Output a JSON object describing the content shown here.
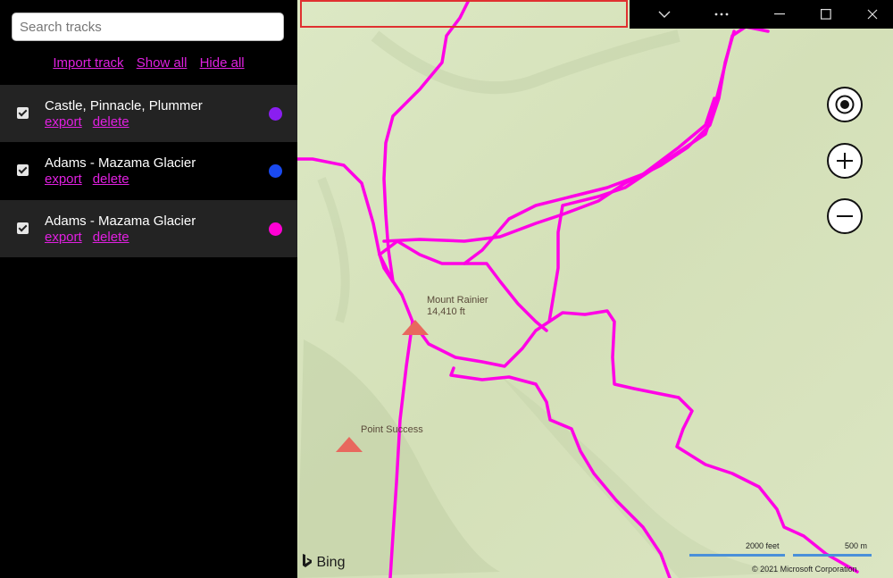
{
  "sidebar": {
    "search_placeholder": "Search tracks",
    "actions": {
      "import": "Import track",
      "show_all": "Show all",
      "hide_all": "Hide all"
    },
    "tracks": [
      {
        "name": "Castle, Pinnacle, Plummer",
        "export": "export",
        "delete": "delete",
        "color": "#8a1ef0",
        "checked": true
      },
      {
        "name": "Adams - Mazama Glacier",
        "export": "export",
        "delete": "delete",
        "color": "#1a4af0",
        "checked": true
      },
      {
        "name": "Adams - Mazama Glacier",
        "export": "export",
        "delete": "delete",
        "color": "#ff00d4",
        "checked": true
      }
    ]
  },
  "window_controls": {
    "chevron": "chevron-down-icon",
    "more": "more-icon",
    "minimize": "minimize-icon",
    "maximize": "maximize-icon",
    "close": "close-icon"
  },
  "map": {
    "pois": [
      {
        "name": "Mount Rainier",
        "detail": "14,410 ft"
      },
      {
        "name": "Point Success"
      }
    ],
    "controls": {
      "locate": "locate-icon",
      "zoom_in": "zoom-in-icon",
      "zoom_out": "zoom-out-icon"
    },
    "brand": "Bing",
    "scale_feet": "2000 feet",
    "scale_m": "500 m",
    "copyright": "© 2021 Microsoft Corporation",
    "track_color": "#ff00e6",
    "terrain_color": "#d8e4bc"
  }
}
